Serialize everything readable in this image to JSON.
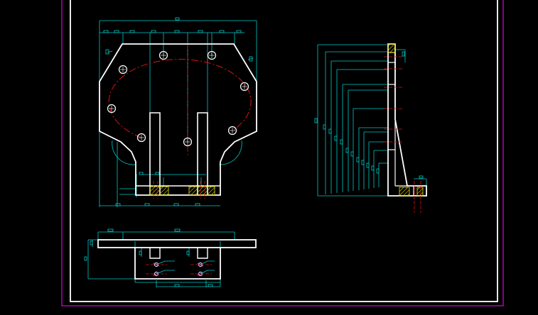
{
  "colors": {
    "background": "#000000",
    "outer_border": "#b400b4",
    "inner_frame": "#ffffff",
    "outline": "#ffffff",
    "dimension": "#00c8c8",
    "center_line": "#e01010",
    "hatch": "#e8e000",
    "leader": "#00a0ff"
  },
  "drawing": {
    "views": [
      {
        "name": "front-view",
        "description": ""
      },
      {
        "name": "side-view",
        "description": ""
      },
      {
        "name": "top-view",
        "description": ""
      }
    ]
  }
}
